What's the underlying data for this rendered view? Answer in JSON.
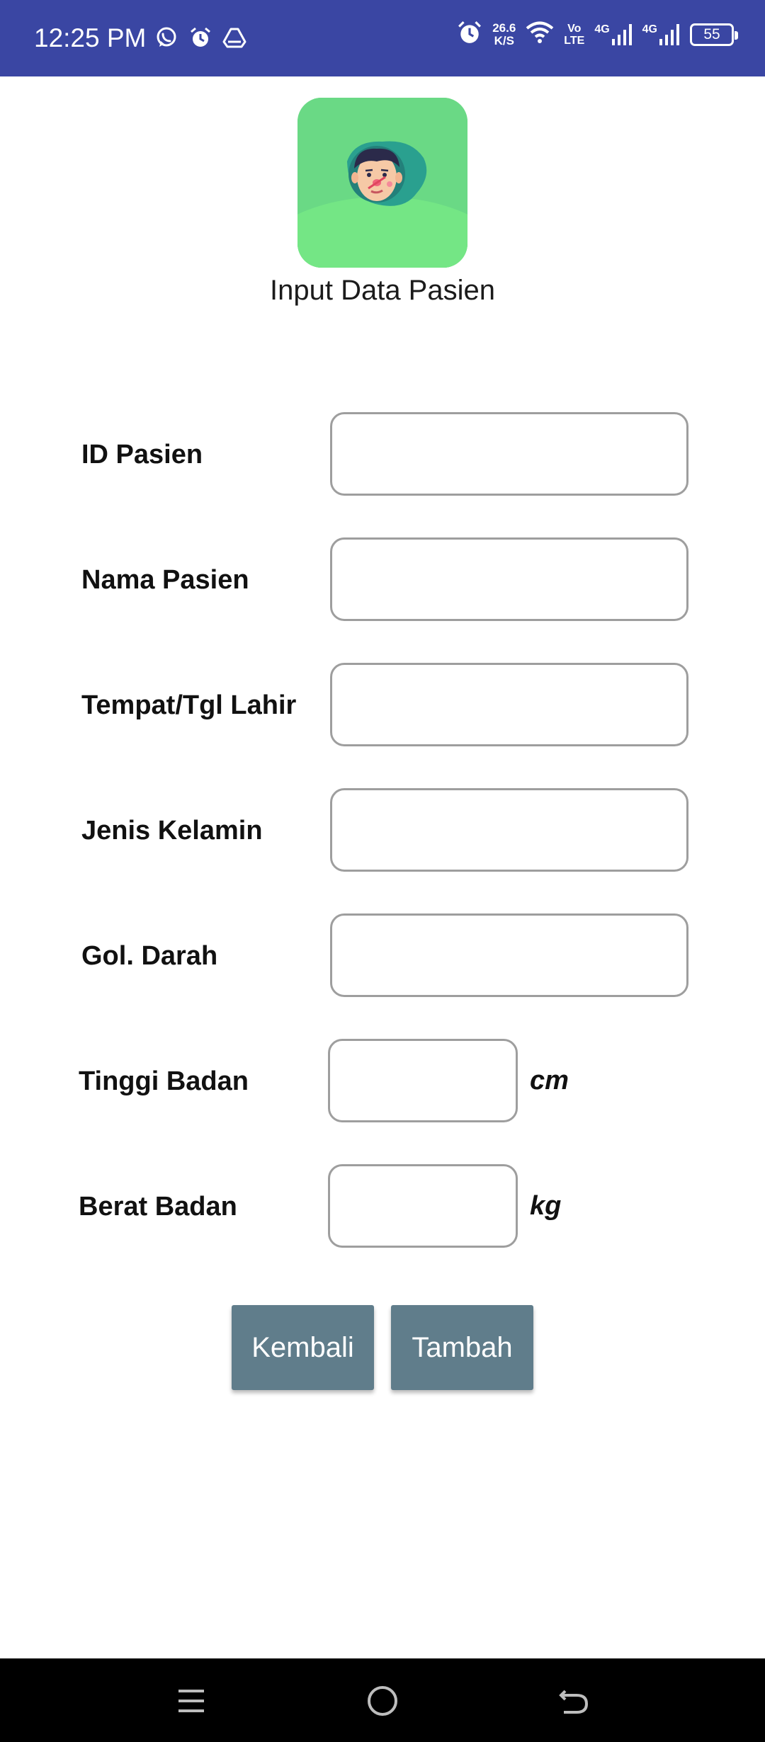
{
  "status_bar": {
    "time": "12:25 PM",
    "left_icons": [
      "whatsapp-icon",
      "alarm-icon",
      "drive-icon"
    ],
    "net_speed_value": "26.6",
    "net_speed_unit": "K/S",
    "volte_top": "Vo",
    "volte_bottom": "LTE",
    "signal1_label": "4G",
    "signal2_label": "4G",
    "battery": "55"
  },
  "header": {
    "title": "Input Data Pasien",
    "logo": "patient-avatar-icon"
  },
  "form": {
    "id_label": "ID Pasien",
    "id_value": "",
    "name_label": "Nama Pasien",
    "name_value": "",
    "birth_label": "Tempat/Tgl Lahir",
    "birth_value": "",
    "gender_label": "Jenis Kelamin",
    "gender_value": "",
    "blood_label": "Gol. Darah",
    "blood_value": "",
    "height_label": "Tinggi Badan",
    "height_value": "",
    "height_unit": "cm",
    "weight_label": "Berat Badan",
    "weight_value": "",
    "weight_unit": "kg"
  },
  "buttons": {
    "back": "Kembali",
    "add": "Tambah"
  },
  "colors": {
    "status_bar": "#3a46a3",
    "button": "#607d8b",
    "logo_bg": "#72df84"
  },
  "nav": [
    "menu-icon",
    "home-icon",
    "back-icon"
  ]
}
